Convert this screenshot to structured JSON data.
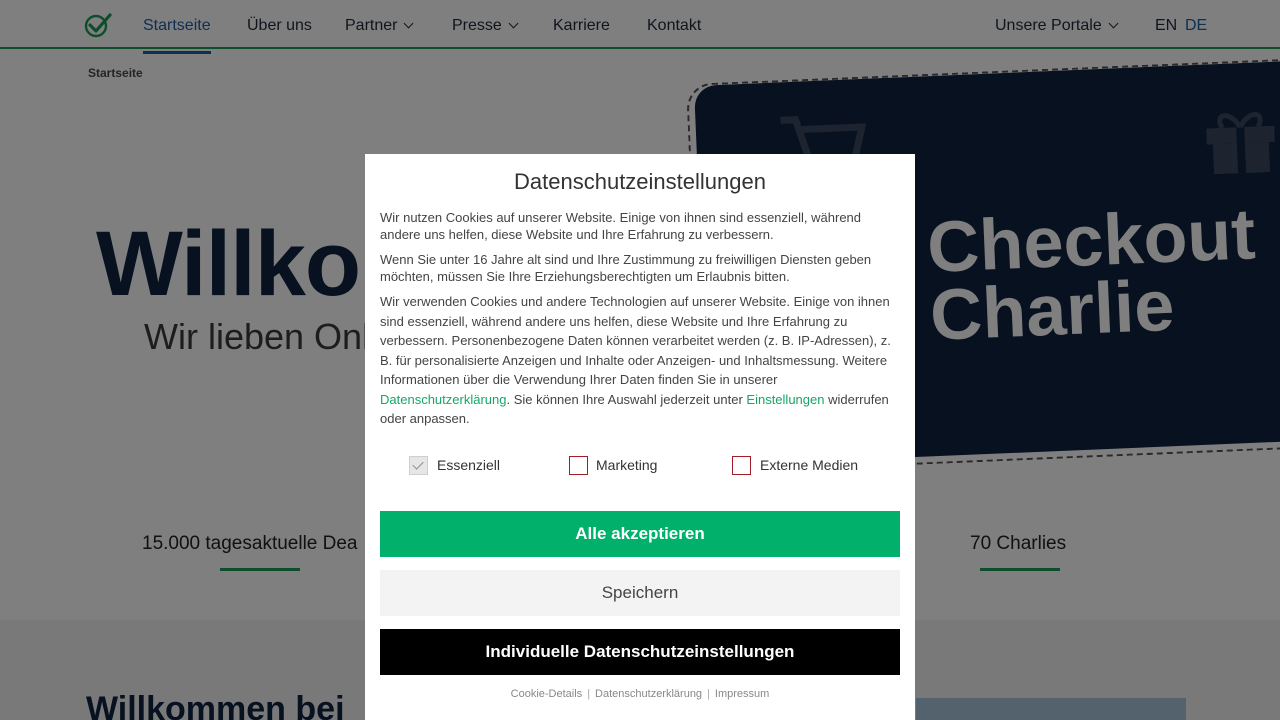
{
  "nav": {
    "items": [
      {
        "label": "Startseite",
        "active": true,
        "dropdown": false
      },
      {
        "label": "Über uns",
        "active": false,
        "dropdown": false
      },
      {
        "label": "Partner",
        "active": false,
        "dropdown": true
      },
      {
        "label": "Presse",
        "active": false,
        "dropdown": true
      },
      {
        "label": "Karriere",
        "active": false,
        "dropdown": false
      },
      {
        "label": "Kontakt",
        "active": false,
        "dropdown": false
      }
    ],
    "portals": "Unsere Portale",
    "languages": [
      {
        "label": "EN",
        "active": false
      },
      {
        "label": "DE",
        "active": true
      }
    ]
  },
  "page": {
    "breadcrumb": "Startseite",
    "hero_title": "Willko",
    "hero_sub": "Wir lieben Onl",
    "card_brand_line1": "Checkout",
    "card_brand_line2": "Charlie",
    "stats": [
      "15.000 tagesaktuelle Dea",
      "70 Charlies"
    ],
    "section_title": "Willkommen bei"
  },
  "modal": {
    "title": "Datenschutzeinstellungen",
    "p1": "Wir nutzen Cookies auf unserer Website. Einige von ihnen sind essenziell, während andere uns helfen, diese Website und Ihre Erfahrung zu verbessern.",
    "p2": "Wenn Sie unter 16 Jahre alt sind und Ihre Zustimmung zu freiwilligen Diensten geben möchten, müssen Sie Ihre Erziehungsberechtigten um Erlaubnis bitten.",
    "p3_a": "Wir verwenden Cookies und andere Technologien auf unserer Website. Einige von ihnen sind essenziell, während andere uns helfen, diese Website und Ihre Erfahrung zu verbessern. Personenbezogene Daten können verarbeitet werden (z. B. IP-Adressen), z. B. für personalisierte Anzeigen und Inhalte oder Anzeigen- und Inhaltsmessung. Weitere Informationen über die Verwendung Ihrer Daten finden Sie in unserer ",
    "p3_link1": "Datenschutzerklärung",
    "p3_b": ". Sie können Ihre Auswahl jederzeit unter ",
    "p3_link2": "Einstellungen",
    "p3_c": " widerrufen oder anpassen.",
    "checkboxes": [
      {
        "label": "Essenziell",
        "checked": true,
        "disabled": true
      },
      {
        "label": "Marketing",
        "checked": false,
        "disabled": false
      },
      {
        "label": "Externe Medien",
        "checked": false,
        "disabled": false
      }
    ],
    "btn_accept": "Alle akzeptieren",
    "btn_save": "Speichern",
    "btn_individual": "Individuelle Datenschutzeinstellungen",
    "footer_links": [
      "Cookie-Details",
      "Datenschutzerklärung",
      "Impressum"
    ],
    "footer_separator": "|"
  },
  "colors": {
    "accent_green": "#00b06b",
    "nav_active": "#1d5fa3",
    "navy": "#0f2340",
    "checkbox_border": "#a01e2a"
  },
  "icons": [
    "checkmark-logo-icon",
    "chevron-down-icon",
    "cart-icon",
    "gift-icon",
    "checkmark-icon"
  ]
}
